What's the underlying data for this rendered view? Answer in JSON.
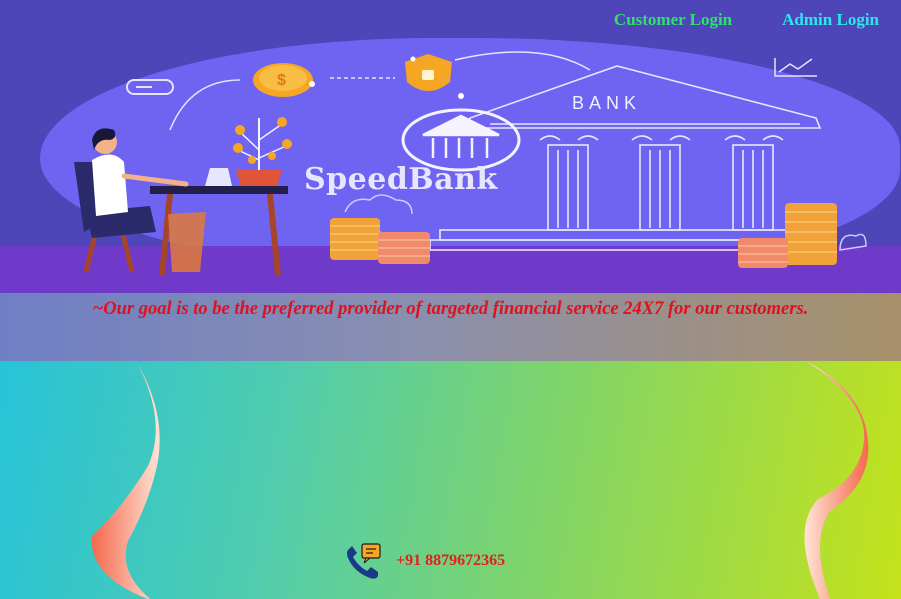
{
  "nav": {
    "customer_login": "Customer Login",
    "admin_login": "Admin Login"
  },
  "hero": {
    "brand_name": "SpeedBank",
    "bank_sign": "BANK",
    "currency_symbol": "$"
  },
  "tagline": "~Our goal is to be the preferred provider of targeted financial service 24X7 for our customers.",
  "contact": {
    "phone": "+91 8879672365",
    "icon": "phone-chat-icon"
  },
  "colors": {
    "hero_bg": "#4d45b8",
    "hero_blob": "#6f63f2",
    "nav_customer": "#2fe26a",
    "nav_admin": "#2ae8e8",
    "tagline_text": "#e01020",
    "main_gradient_start": "#27c3d8",
    "main_gradient_end": "#c4e21a",
    "wave_accent": "#f5684c"
  }
}
